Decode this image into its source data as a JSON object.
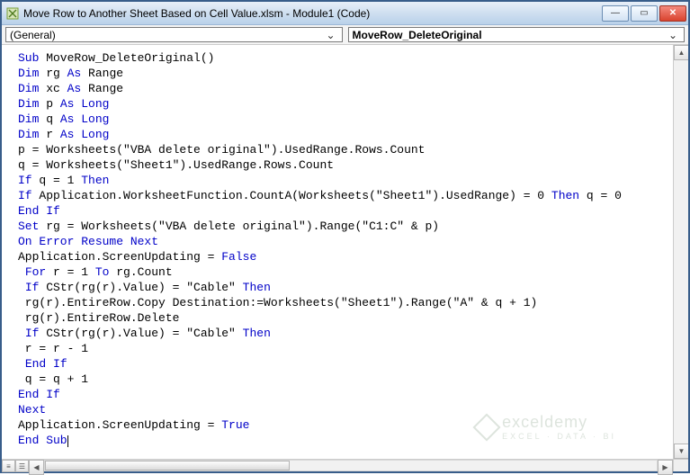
{
  "window": {
    "title": "Move Row to Another Sheet Based on Cell Value.xlsm - Module1 (Code)"
  },
  "dropdowns": {
    "object": "(General)",
    "procedure": "MoveRow_DeleteOriginal"
  },
  "code": {
    "lines": [
      [
        [
          "kw",
          "Sub"
        ],
        [
          "",
          " MoveRow_DeleteOriginal()"
        ]
      ],
      [
        [
          "kw",
          "Dim"
        ],
        [
          "",
          " rg "
        ],
        [
          "kw",
          "As"
        ],
        [
          "",
          " Range"
        ]
      ],
      [
        [
          "kw",
          "Dim"
        ],
        [
          "",
          " xc "
        ],
        [
          "kw",
          "As"
        ],
        [
          "",
          " Range"
        ]
      ],
      [
        [
          "kw",
          "Dim"
        ],
        [
          "",
          " p "
        ],
        [
          "kw",
          "As Long"
        ]
      ],
      [
        [
          "kw",
          "Dim"
        ],
        [
          "",
          " q "
        ],
        [
          "kw",
          "As Long"
        ]
      ],
      [
        [
          "kw",
          "Dim"
        ],
        [
          "",
          " r "
        ],
        [
          "kw",
          "As Long"
        ]
      ],
      [
        [
          "",
          "p = Worksheets(\"VBA delete original\").UsedRange.Rows.Count"
        ]
      ],
      [
        [
          "",
          "q = Worksheets(\"Sheet1\").UsedRange.Rows.Count"
        ]
      ],
      [
        [
          "kw",
          "If"
        ],
        [
          "",
          " q = 1 "
        ],
        [
          "kw",
          "Then"
        ]
      ],
      [
        [
          "kw",
          "If"
        ],
        [
          "",
          " Application.WorksheetFunction.CountA(Worksheets(\"Sheet1\").UsedRange) = 0 "
        ],
        [
          "kw",
          "Then"
        ],
        [
          "",
          " q = 0"
        ]
      ],
      [
        [
          "kw",
          "End If"
        ]
      ],
      [
        [
          "kw",
          "Set"
        ],
        [
          "",
          " rg = Worksheets(\"VBA delete original\").Range(\"C1:C\" & p)"
        ]
      ],
      [
        [
          "kw",
          "On Error Resume Next"
        ]
      ],
      [
        [
          "",
          "Application.ScreenUpdating = "
        ],
        [
          "kw",
          "False"
        ]
      ],
      [
        [
          "",
          " "
        ],
        [
          "kw",
          "For"
        ],
        [
          "",
          " r = 1 "
        ],
        [
          "kw",
          "To"
        ],
        [
          "",
          " rg.Count"
        ]
      ],
      [
        [
          "",
          " "
        ],
        [
          "kw",
          "If"
        ],
        [
          "",
          " CStr(rg(r).Value) = \"Cable\" "
        ],
        [
          "kw",
          "Then"
        ]
      ],
      [
        [
          "",
          " rg(r).EntireRow.Copy Destination:=Worksheets(\"Sheet1\").Range(\"A\" & q + 1)"
        ]
      ],
      [
        [
          "",
          " rg(r).EntireRow.Delete"
        ]
      ],
      [
        [
          "",
          " "
        ],
        [
          "kw",
          "If"
        ],
        [
          "",
          " CStr(rg(r).Value) = \"Cable\" "
        ],
        [
          "kw",
          "Then"
        ]
      ],
      [
        [
          "",
          " r = r - 1"
        ]
      ],
      [
        [
          "",
          " "
        ],
        [
          "kw",
          "End If"
        ]
      ],
      [
        [
          "",
          " q = q + 1"
        ]
      ],
      [
        [
          "kw",
          "End If"
        ]
      ],
      [
        [
          "kw",
          "Next"
        ]
      ],
      [
        [
          "",
          "Application.ScreenUpdating = "
        ],
        [
          "kw",
          "True"
        ]
      ],
      [
        [
          "kw",
          "End Sub"
        ]
      ]
    ]
  },
  "watermark": {
    "brand": "exceldemy",
    "tagline": "EXCEL · DATA · BI"
  }
}
